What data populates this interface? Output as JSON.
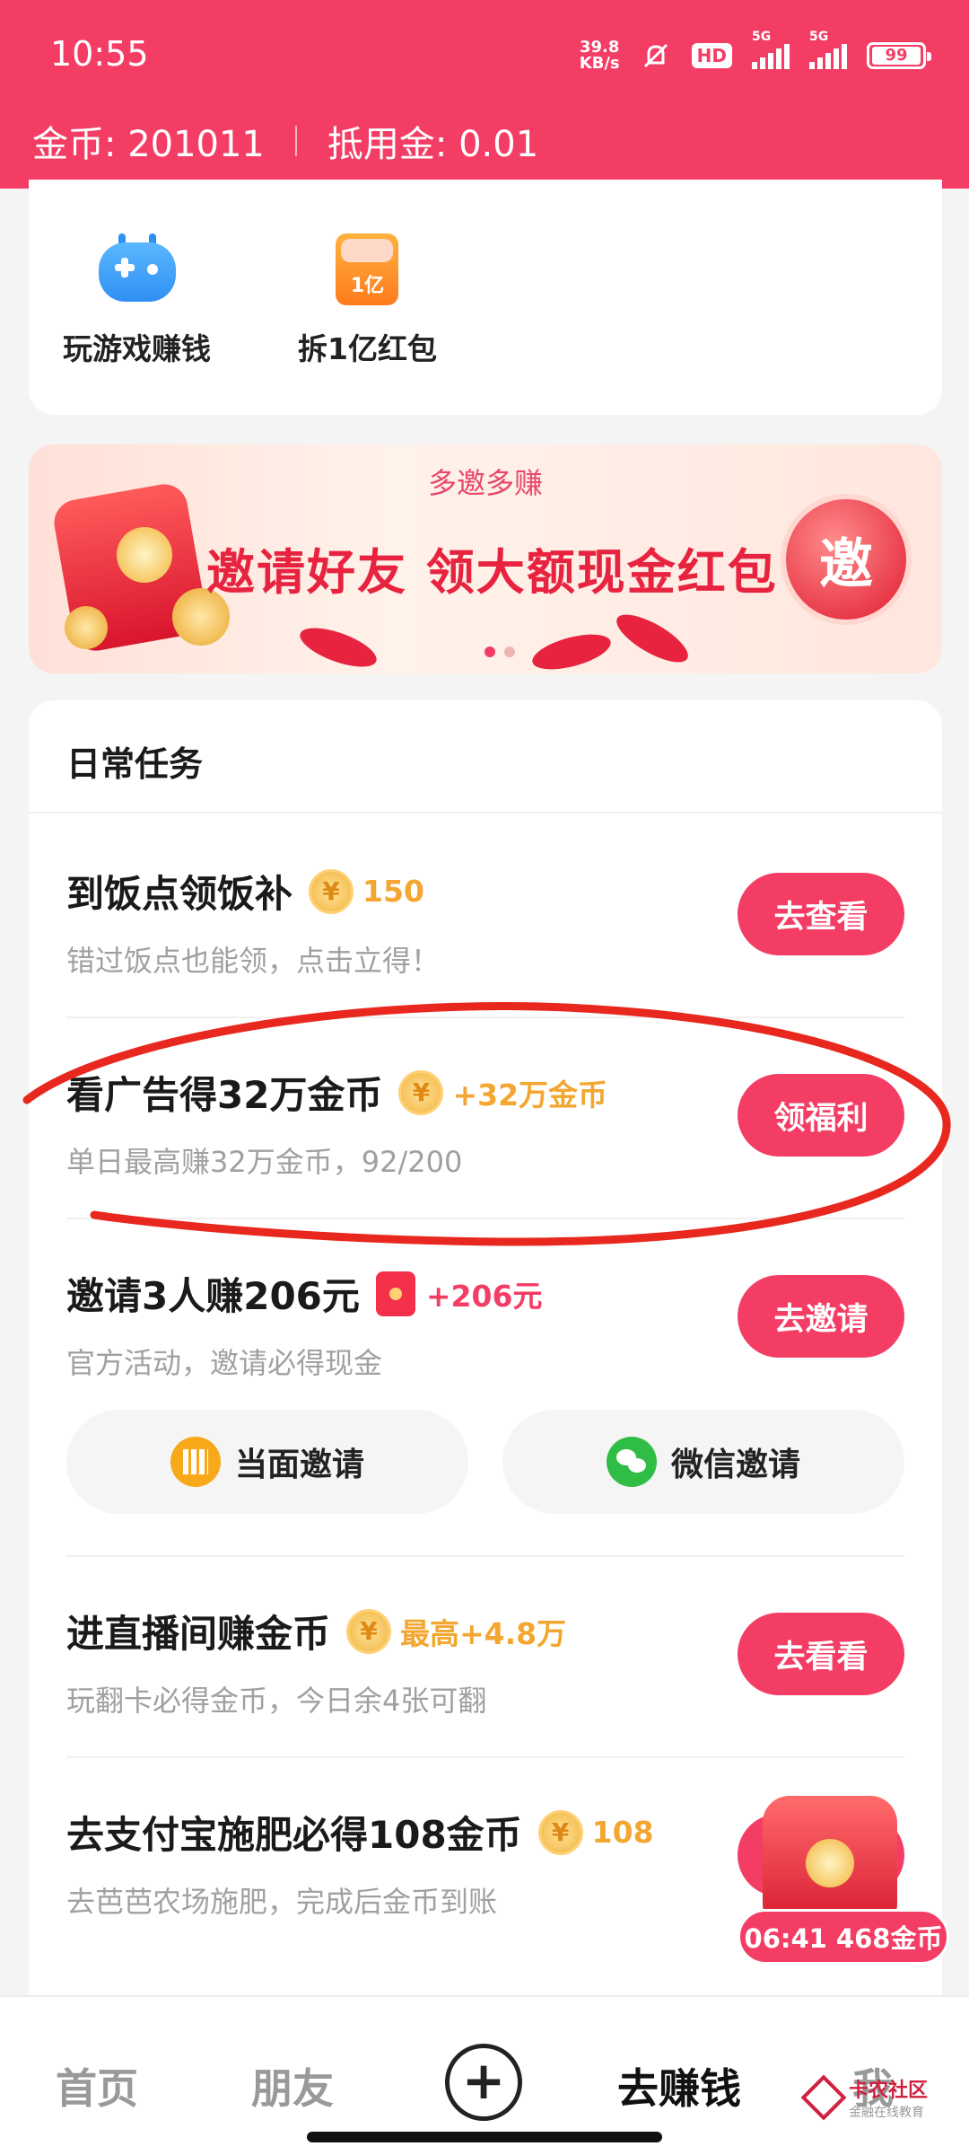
{
  "status": {
    "time": "10:55",
    "net_speed_value": "39.8",
    "net_speed_unit": "KB/s",
    "hd_badge": "HD",
    "sim_label_1": "5G",
    "sim_label_2": "5G",
    "battery": "99"
  },
  "header": {
    "coins_text": "金币: 201011",
    "voucher_text": "抵用金: 0.01"
  },
  "shortcuts": [
    {
      "label": "玩游戏赚钱",
      "icon": "gamepad-icon"
    },
    {
      "label": "拆1亿红包",
      "icon": "red-envelope-icon",
      "icon_text": "1亿"
    }
  ],
  "banner": {
    "subtitle": "多邀多赚",
    "title": "邀请好友 领大额现金红包",
    "button_text": "邀",
    "active_dot": 0
  },
  "daily_tasks": {
    "heading": "日常任务",
    "tasks": [
      {
        "title": "到饭点领饭补",
        "reward": "150",
        "reward_icon": "coin-icon",
        "desc": "错过饭点也能领，点击立得！",
        "button": "去查看"
      },
      {
        "title": "看广告得32万金币",
        "reward": "+32万金币",
        "reward_icon": "coin-icon",
        "desc": "单日最高赚32万金币，92/200",
        "button": "领福利"
      },
      {
        "title": "邀请3人赚206元",
        "reward": "+206元",
        "reward_icon": "red-envelope-icon",
        "desc": "官方活动，邀请必得现金",
        "button": "去邀请"
      },
      {
        "title": "进直播间赚金币",
        "reward": "最高+4.8万",
        "reward_icon": "coin-icon",
        "desc": "玩翻卡必得金币，今日余4张可翻",
        "button": "去看看"
      },
      {
        "title": "去支付宝施肥必得108金币",
        "reward": "108",
        "reward_icon": "coin-icon",
        "desc": "去芭芭农场施肥，完成后金币到账",
        "button": ""
      }
    ],
    "invite_options": [
      {
        "label": "当面邀请",
        "icon": "qr-code-icon"
      },
      {
        "label": "微信邀请",
        "icon": "wechat-icon"
      }
    ]
  },
  "coin_symbol": "¥",
  "float_widget": {
    "text": "06:41 468金币"
  },
  "bottom_nav": {
    "items": [
      "首页",
      "朋友",
      "+",
      "去赚钱",
      "我"
    ],
    "active": "去赚钱"
  },
  "watermark": {
    "main": "卡农社区",
    "sub": "金融在线教育"
  },
  "colors": {
    "primary": "#f43d65",
    "coin": "#f3a630",
    "annotation": "#e8281e"
  }
}
